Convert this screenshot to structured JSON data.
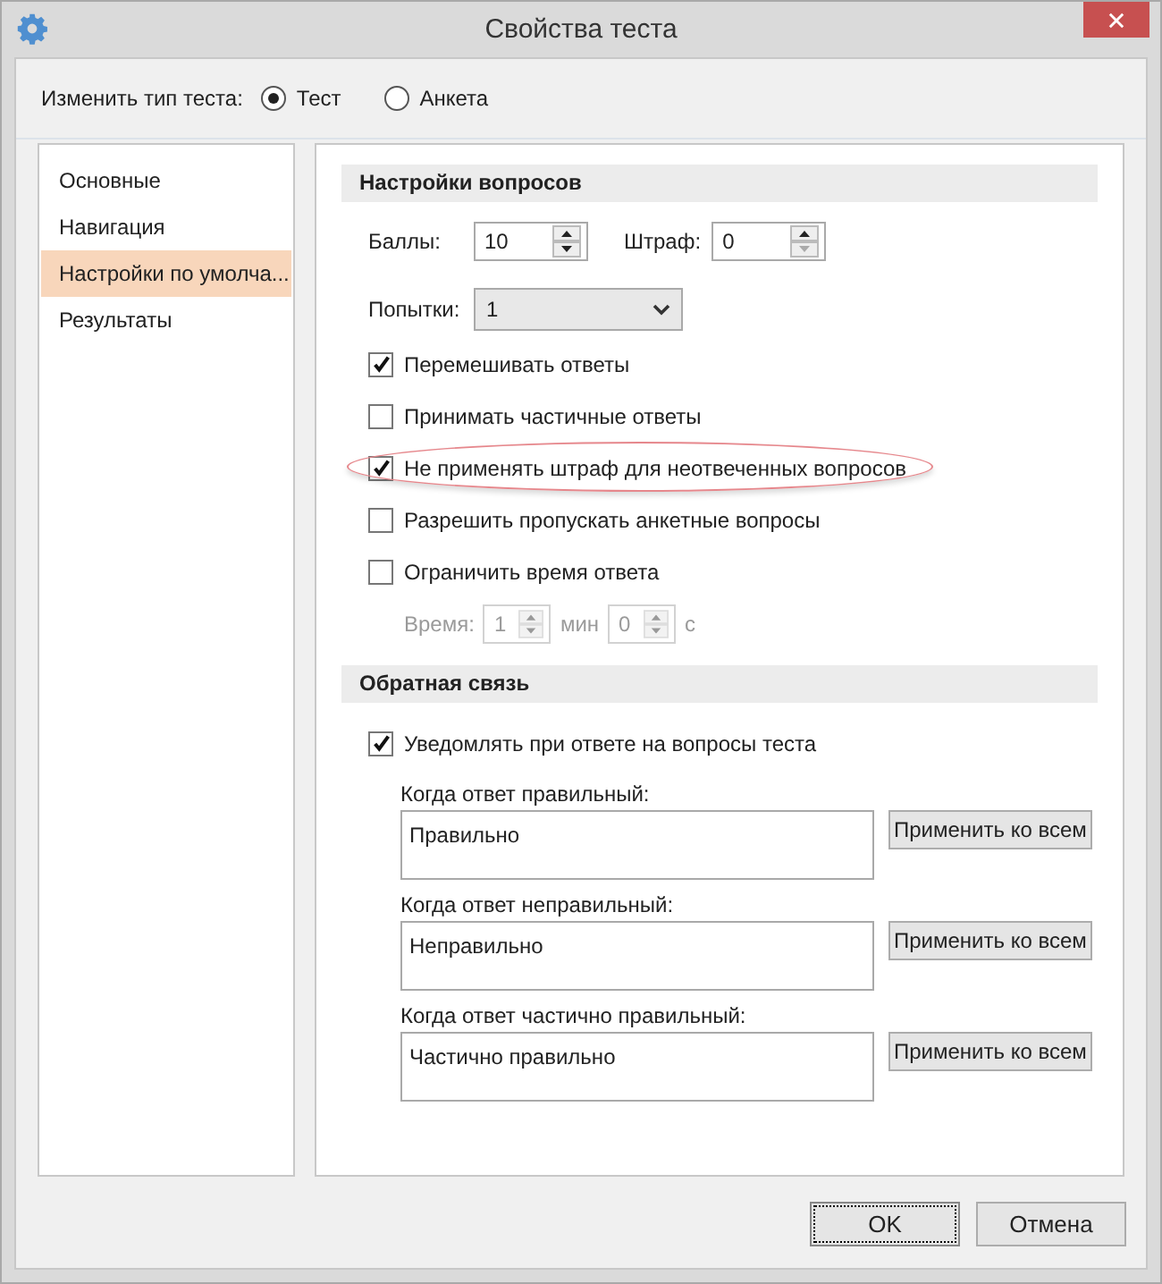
{
  "window": {
    "title": "Свойства теста"
  },
  "test_type": {
    "label": "Изменить тип теста:",
    "options": [
      {
        "label": "Тест",
        "selected": true
      },
      {
        "label": "Анкета",
        "selected": false
      }
    ]
  },
  "sidebar": {
    "items": [
      {
        "label": "Основные",
        "selected": false
      },
      {
        "label": "Навигация",
        "selected": false
      },
      {
        "label": "Настройки по умолча...",
        "selected": true
      },
      {
        "label": "Результаты",
        "selected": false
      }
    ]
  },
  "question_settings": {
    "title": "Настройки вопросов",
    "score": {
      "label": "Баллы:",
      "value": "10"
    },
    "penalty": {
      "label": "Штраф:",
      "value": "0"
    },
    "attempts": {
      "label": "Попытки:",
      "value": "1"
    },
    "options": [
      {
        "label": "Перемешивать ответы",
        "checked": true,
        "highlighted": false
      },
      {
        "label": "Принимать частичные ответы",
        "checked": false,
        "highlighted": false
      },
      {
        "label": "Не применять штраф для неотвеченных вопросов",
        "checked": true,
        "highlighted": true
      },
      {
        "label": "Разрешить пропускать анкетные вопросы",
        "checked": false,
        "highlighted": false
      },
      {
        "label": "Ограничить время ответа",
        "checked": false,
        "highlighted": false
      }
    ],
    "time_limit": {
      "label": "Время:",
      "minutes": "1",
      "minutes_unit": "мин",
      "seconds": "0",
      "seconds_unit": "с",
      "disabled": true
    }
  },
  "feedback": {
    "title": "Обратная связь",
    "notify": {
      "label": "Уведомлять при ответе на вопросы теста",
      "checked": true
    },
    "messages": [
      {
        "label": "Когда ответ правильный:",
        "value": "Правильно",
        "button": "Применить ко всем"
      },
      {
        "label": "Когда ответ неправильный:",
        "value": "Неправильно",
        "button": "Применить ко всем"
      },
      {
        "label": "Когда ответ частично правильный:",
        "value": "Частично правильно",
        "button": "Применить ко всем"
      }
    ]
  },
  "buttons": [
    {
      "label": "OK",
      "default": true
    },
    {
      "label": "Отмена",
      "default": false
    }
  ]
}
